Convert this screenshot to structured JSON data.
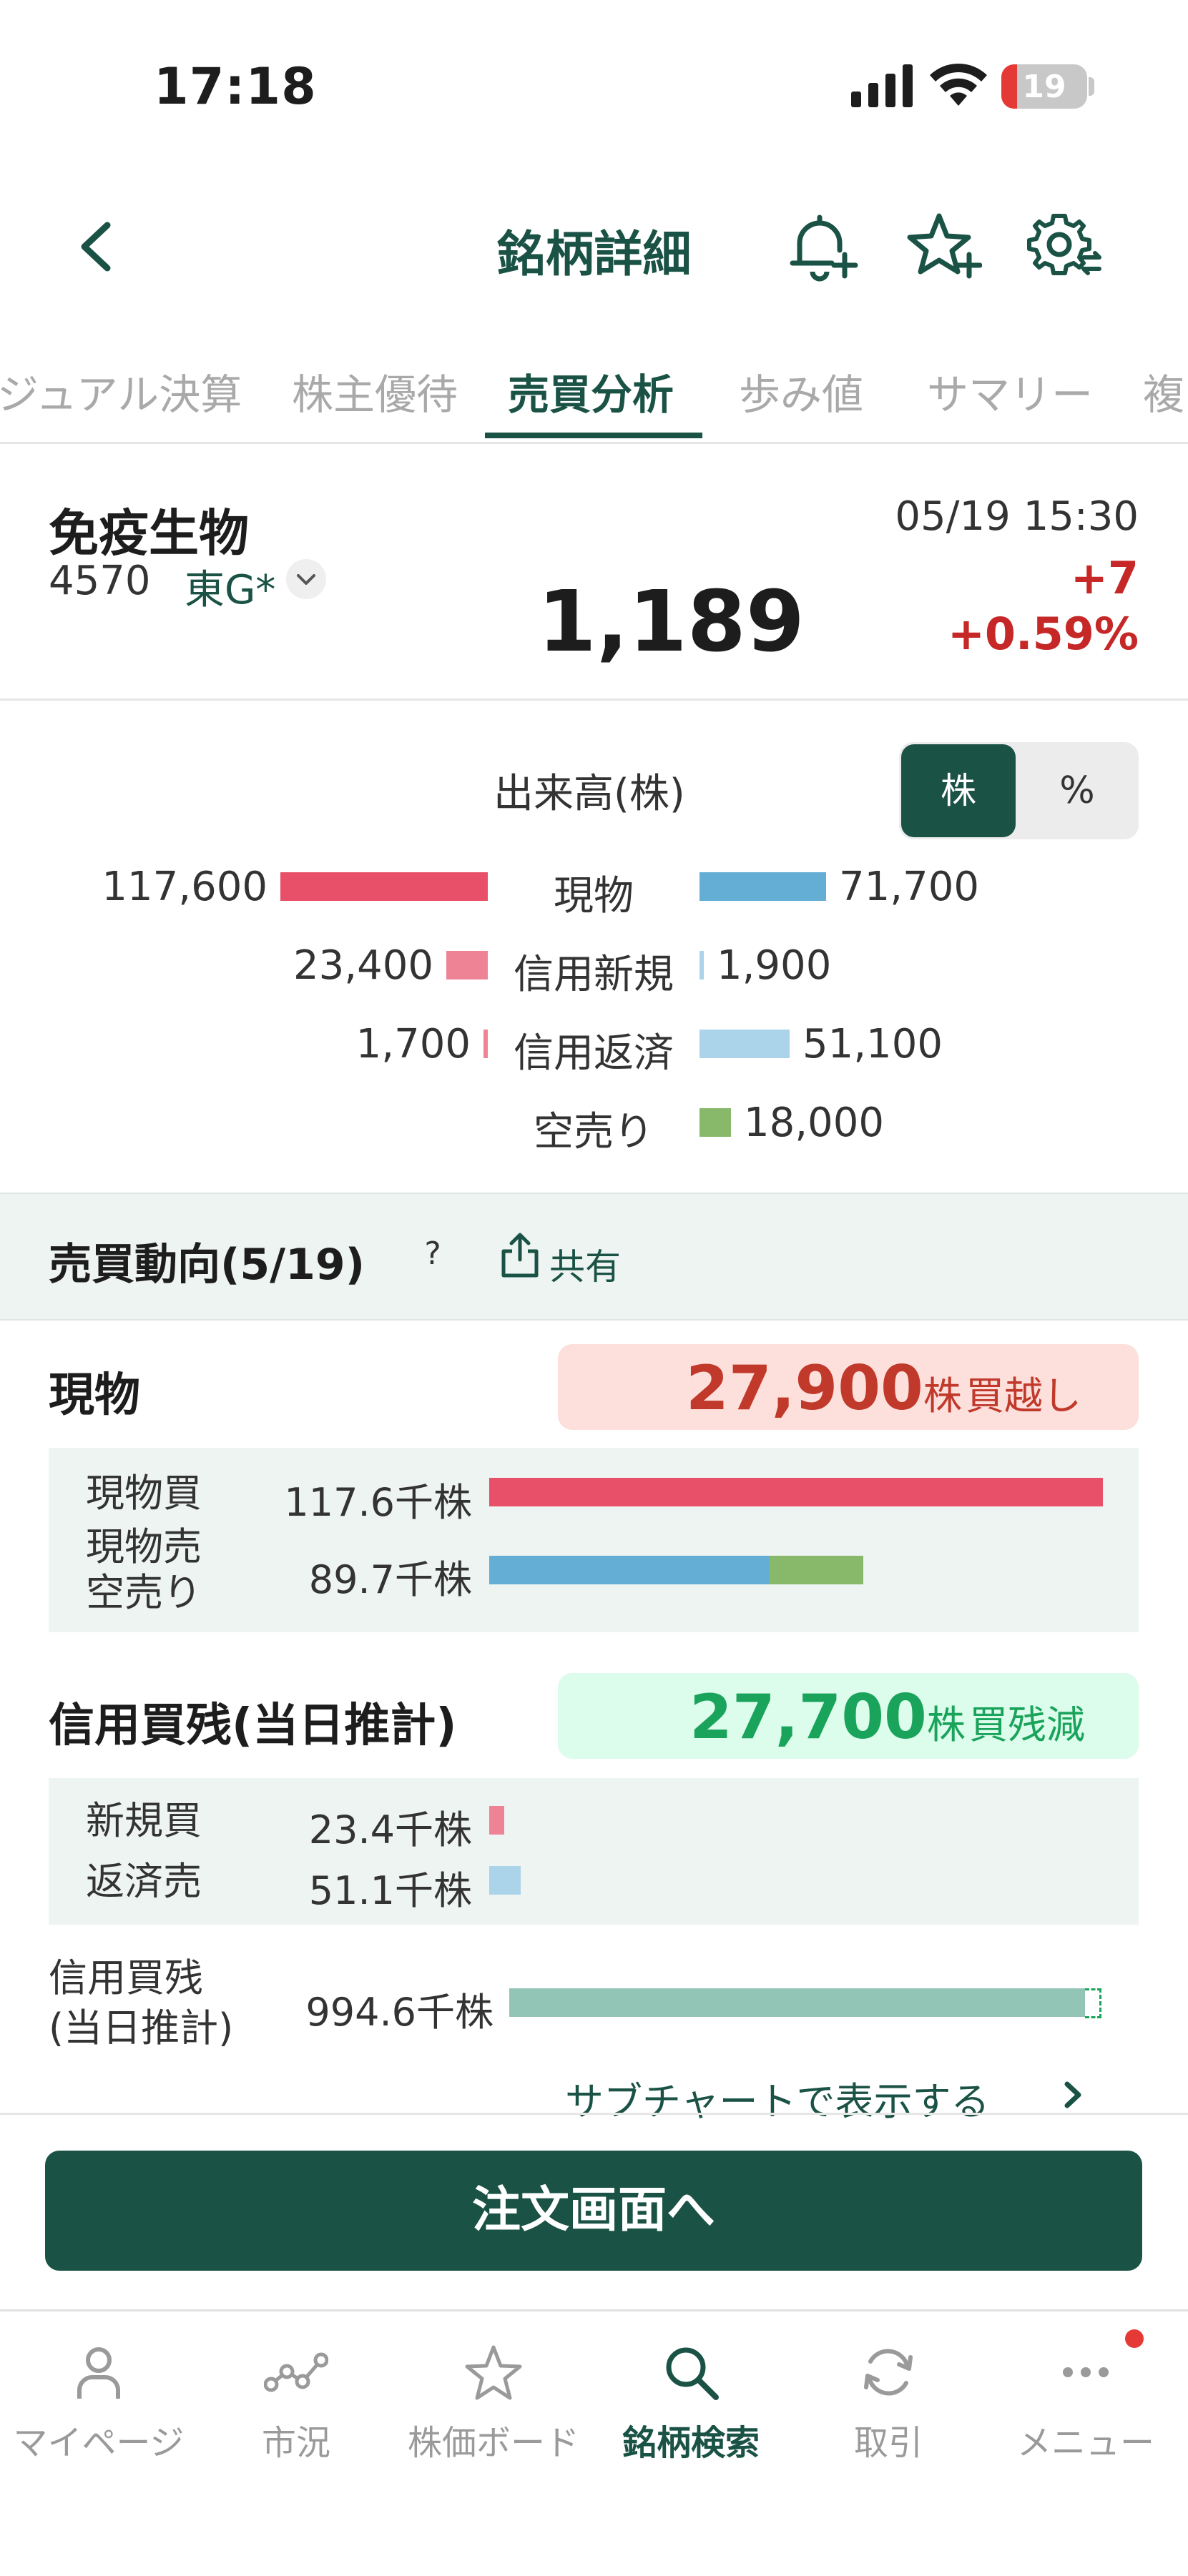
{
  "status_bar": {
    "time": "17:18",
    "battery": "19"
  },
  "header": {
    "title": "銘柄詳細"
  },
  "tabs": [
    {
      "label": "ジュアル決算"
    },
    {
      "label": "株主優待"
    },
    {
      "label": "売買分析"
    },
    {
      "label": "歩み値"
    },
    {
      "label": "サマリー"
    },
    {
      "label": "複"
    }
  ],
  "stock": {
    "name": "免疫生物",
    "code": "4570",
    "market": "東G*",
    "price": "1,189",
    "datetime": "05/19 15:30",
    "change": "+7",
    "change_pct": "+0.59%"
  },
  "volume": {
    "title": "出来高(株)",
    "toggle": {
      "shares": "株",
      "percent": "%"
    },
    "rows": [
      {
        "label": "現物",
        "left_value": "117,600",
        "right_value": "71,700",
        "left_ratio": 1.0,
        "right_ratio": 0.61
      },
      {
        "label": "信用新規",
        "left_value": "23,400",
        "right_value": "1,900",
        "left_ratio": 0.199,
        "right_ratio": 0.016
      },
      {
        "label": "信用返済",
        "left_value": "1,700",
        "right_value": "51,100",
        "left_ratio": 0.014,
        "right_ratio": 0.435
      },
      {
        "label": "空売り",
        "left_value": "",
        "right_value": "18,000",
        "left_ratio": 0,
        "right_ratio": 0.153
      }
    ],
    "colors": {
      "buy": "#e8506a",
      "buy_light": "#ef8396",
      "sell": "#64aed6",
      "sell_light": "#abd3ea",
      "short": "#88b86a"
    }
  },
  "trend": {
    "title": "売買動向(5/19)",
    "help": "?",
    "share": "共有",
    "cash": {
      "title": "現物",
      "net_value": "27,900",
      "net_unit": "株",
      "net_label": "買越し",
      "buy_label": "現物買",
      "buy_value": "117.6千株",
      "sell_label_1": "現物売",
      "sell_label_2": "空売り",
      "sell_value": "89.7千株",
      "buy_ratio": 1.0,
      "sell_ratio": 0.61,
      "short_ratio": 0.153
    },
    "margin": {
      "title": "信用買残(当日推計)",
      "net_value": "27,700",
      "net_unit": "株",
      "net_label": "買残減",
      "new_buy_label": "新規買",
      "new_buy_value": "23.4千株",
      "repay_sell_label": "返済売",
      "repay_sell_value": "51.1千株",
      "balance_label_1": "信用買残",
      "balance_label_2": "(当日推計)",
      "balance_value": "994.6千株",
      "new_buy_ratio": 0.024,
      "repay_sell_ratio": 0.051,
      "balance_ratio": 0.97
    },
    "subchart_link": "サブチャートで表示する"
  },
  "order_button": "注文画面へ",
  "nav": [
    {
      "label": "マイページ",
      "icon": "person-icon"
    },
    {
      "label": "市況",
      "icon": "market-icon"
    },
    {
      "label": "株価ボード",
      "icon": "star-icon"
    },
    {
      "label": "銘柄検索",
      "icon": "search-icon"
    },
    {
      "label": "取引",
      "icon": "refresh-icon"
    },
    {
      "label": "メニュー",
      "icon": "more-icon"
    }
  ]
}
